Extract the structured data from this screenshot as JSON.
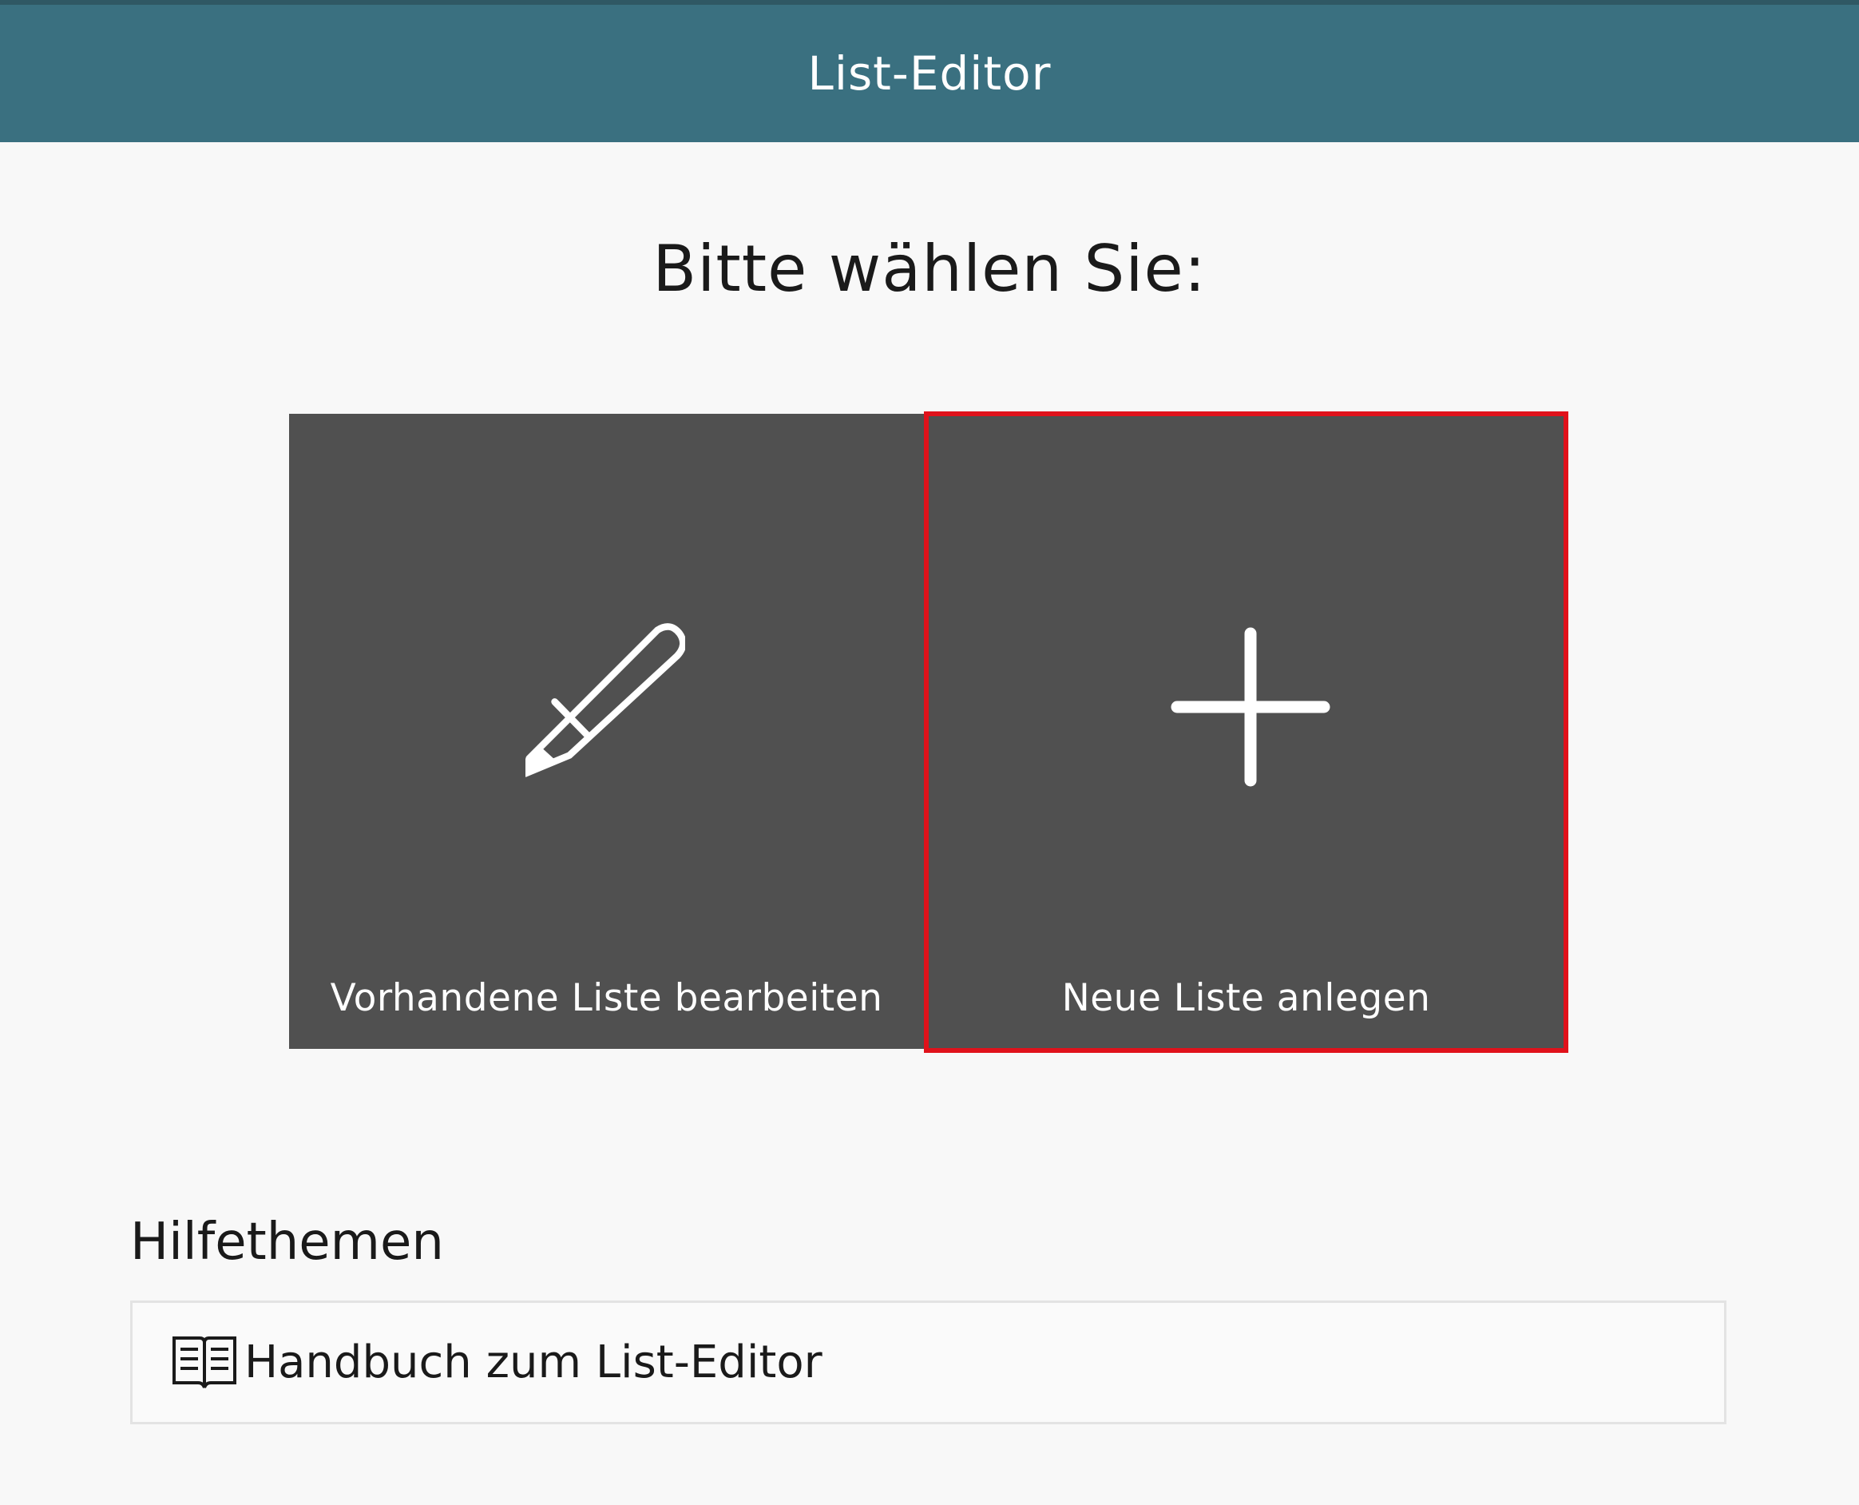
{
  "header": {
    "title": "List-Editor"
  },
  "main": {
    "prompt": "Bitte wählen Sie:",
    "tiles": [
      {
        "label": "Vorhandene Liste bearbeiten",
        "icon": "pencil-icon"
      },
      {
        "label": "Neue Liste anlegen",
        "icon": "plus-icon",
        "highlighted": true
      }
    ]
  },
  "help": {
    "heading": "Hilfethemen",
    "items": [
      {
        "label": "Handbuch zum List-Editor",
        "icon": "book-icon"
      }
    ]
  },
  "colors": {
    "header_bg": "#3a7080",
    "tile_bg": "#505050",
    "highlight_border": "#e0121b",
    "page_bg": "#f8f8f8"
  }
}
